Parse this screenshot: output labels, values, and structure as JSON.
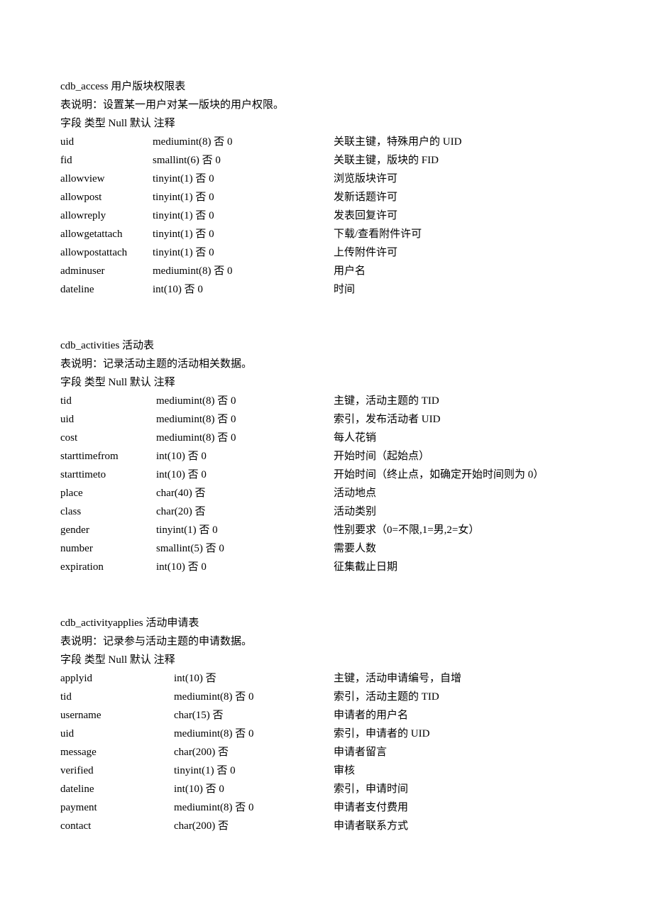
{
  "tables": [
    {
      "name": "cdb_access 用户版块权限表",
      "description": "表说明：设置某一用户对某一版块的用户权限。",
      "header": "字段  类型  Null  默认  注释",
      "rows": [
        {
          "field": "uid",
          "type": "mediumint(8)  否   0",
          "comment": "关联主键，特殊用户的 UID"
        },
        {
          "field": "fid",
          "type": "smallint(6)  否   0",
          "comment": "关联主键，版块的 FID"
        },
        {
          "field": "allowview",
          "type": "tinyint(1)  否   0",
          "comment": "浏览版块许可"
        },
        {
          "field": "allowpost",
          "type": "tinyint(1)  否   0",
          "comment": "发新话题许可"
        },
        {
          "field": "allowreply",
          "type": "tinyint(1)  否   0",
          "comment": "发表回复许可"
        },
        {
          "field": "allowgetattach",
          "type": "tinyint(1)  否   0",
          "comment": "下载/查看附件许可"
        },
        {
          "field": "allowpostattach",
          "type": "tinyint(1)  否   0",
          "comment": "上传附件许可"
        },
        {
          "field": "adminuser",
          "type": "mediumint(8)  否   0",
          "comment": "用户名"
        },
        {
          "field": "dateline",
          "type": "int(10)  否   0",
          "comment": "时间"
        }
      ]
    },
    {
      "name": "cdb_activities 活动表",
      "description": "表说明：记录活动主题的活动相关数据。",
      "header": "字段  类型  Null  默认  注释",
      "rows": [
        {
          "field": "tid",
          "type": "mediumint(8)  否   0",
          "comment": "主键，活动主题的 TID"
        },
        {
          "field": "uid",
          "type": "mediumint(8)  否   0",
          "comment": "索引，发布活动者 UID"
        },
        {
          "field": "cost",
          "type": "mediumint(8)  否   0",
          "comment": "每人花销"
        },
        {
          "field": "starttimefrom",
          "type": "int(10)  否   0",
          "comment": "开始时间（起始点）"
        },
        {
          "field": "starttimeto",
          "type": "int(10)  否   0",
          "comment": "开始时间（终止点，如确定开始时间则为 0）"
        },
        {
          "field": "place",
          "type": "char(40)  否",
          "comment": "活动地点"
        },
        {
          "field": "class",
          "type": "char(20)  否",
          "comment": "活动类别"
        },
        {
          "field": "gender",
          "type": "tinyint(1)  否   0",
          "comment": "性别要求（0=不限,1=男,2=女）"
        },
        {
          "field": "number",
          "type": "smallint(5)  否   0",
          "comment": "需要人数"
        },
        {
          "field": "expiration",
          "type": "int(10)  否   0",
          "comment": "征集截止日期"
        }
      ]
    },
    {
      "name": "cdb_activityapplies 活动申请表",
      "description": "表说明：记录参与活动主题的申请数据。",
      "header": "字段  类型  Null  默认  注释",
      "rows": [
        {
          "field": "applyid",
          "type": "int(10)  否",
          "comment": "主键，活动申请编号，自增"
        },
        {
          "field": "tid",
          "type": "mediumint(8)  否   0",
          "comment": "索引，活动主题的 TID"
        },
        {
          "field": "username",
          "type": "char(15)  否",
          "comment": "申请者的用户名"
        },
        {
          "field": "uid",
          "type": "mediumint(8)  否   0",
          "comment": "索引，申请者的 UID"
        },
        {
          "field": "message",
          "type": "char(200)  否",
          "comment": "申请者留言"
        },
        {
          "field": "verified",
          "type": "tinyint(1)  否   0",
          "comment": "审核"
        },
        {
          "field": "dateline",
          "type": "int(10)  否   0",
          "comment": "索引，申请时间"
        },
        {
          "field": "payment",
          "type": "mediumint(8)  否   0",
          "comment": "申请者支付费用"
        },
        {
          "field": "contact",
          "type": "char(200)  否",
          "comment": "申请者联系方式"
        }
      ]
    }
  ]
}
